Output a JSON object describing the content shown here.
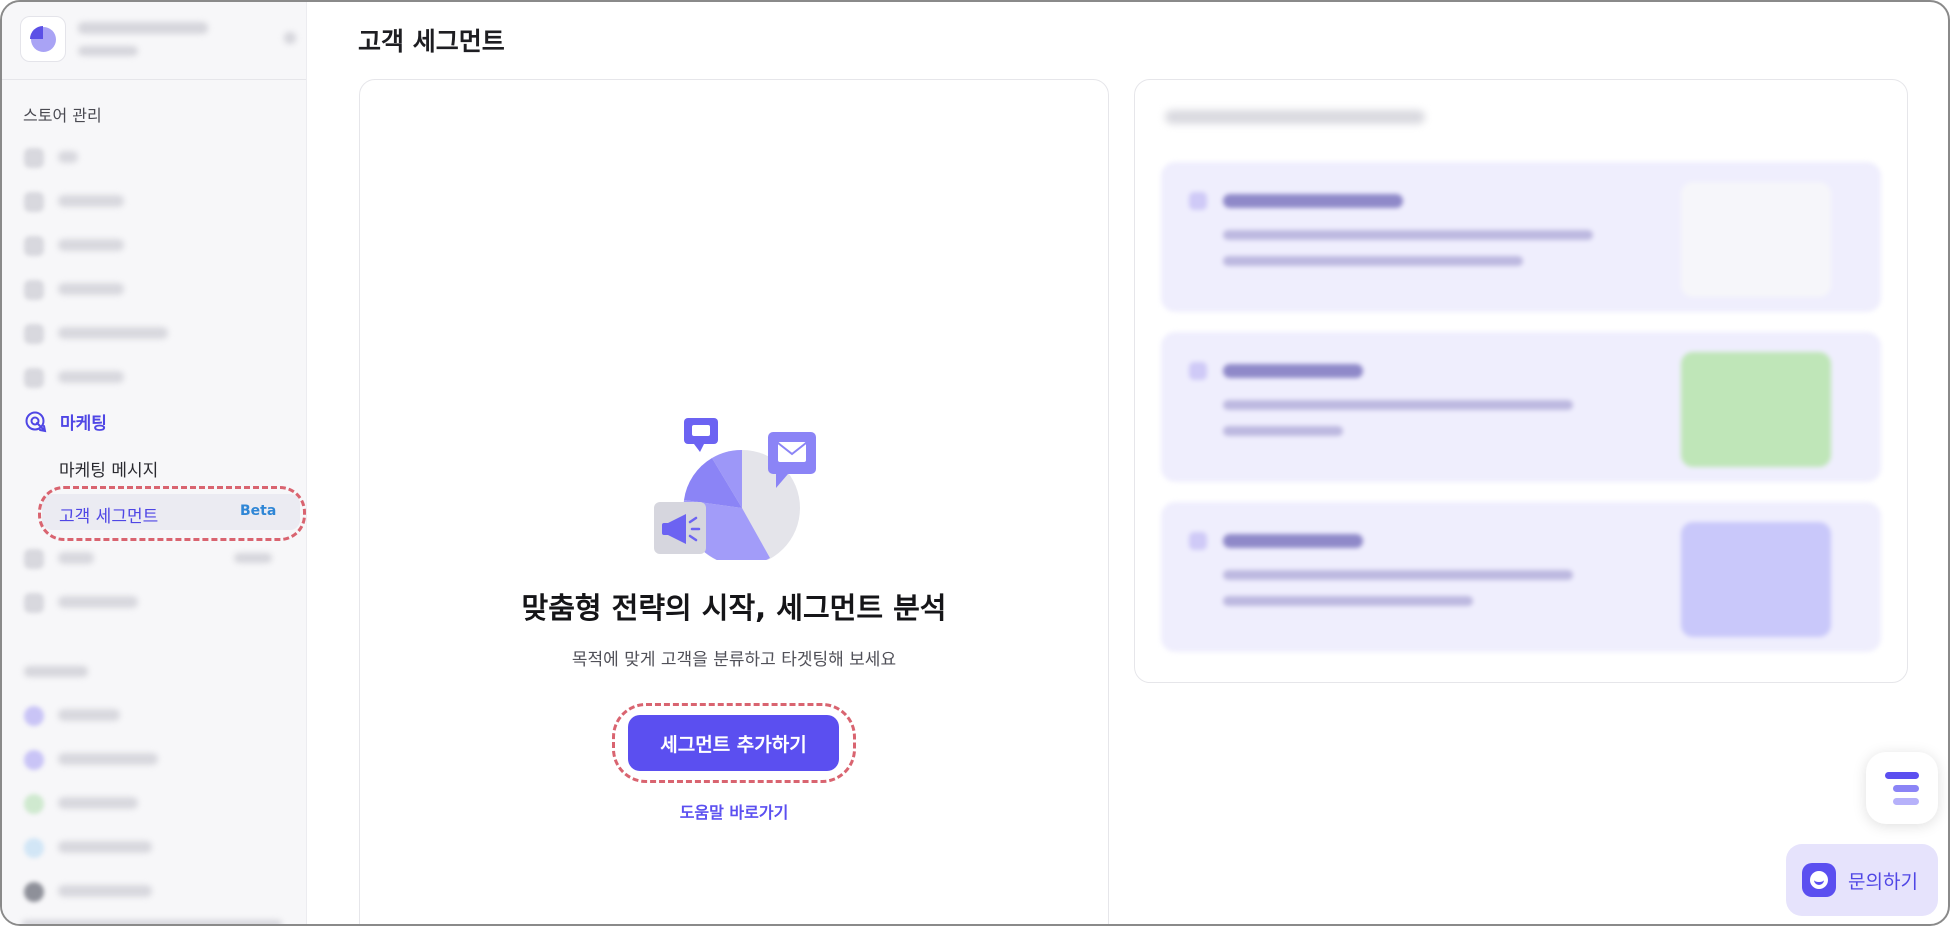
{
  "page": {
    "title": "고객 세그먼트"
  },
  "sidebar": {
    "section_label": "스토어 관리",
    "marketing": {
      "label": "마케팅",
      "icon": "marketing-target-icon"
    },
    "sub_items": [
      {
        "label": "마케팅 메시지"
      },
      {
        "label": "고객 세그먼트",
        "badge": "Beta",
        "active": true
      }
    ]
  },
  "main": {
    "hero_title": "맞춤형 전략의 시작, 세그먼트 분석",
    "hero_subtitle": "목적에 맞게 고객을 분류하고 타겟팅해 보세요",
    "cta_label": "세그먼트 추가하기",
    "help_link": "도움말 바로가기"
  },
  "floating": {
    "inquiry_label": "문의하기",
    "menu_icon": "menu-lines-icon"
  },
  "colors": {
    "accent": "#5b4ff0",
    "highlight_dash": "#d96470",
    "beta": "#2f86d6"
  }
}
